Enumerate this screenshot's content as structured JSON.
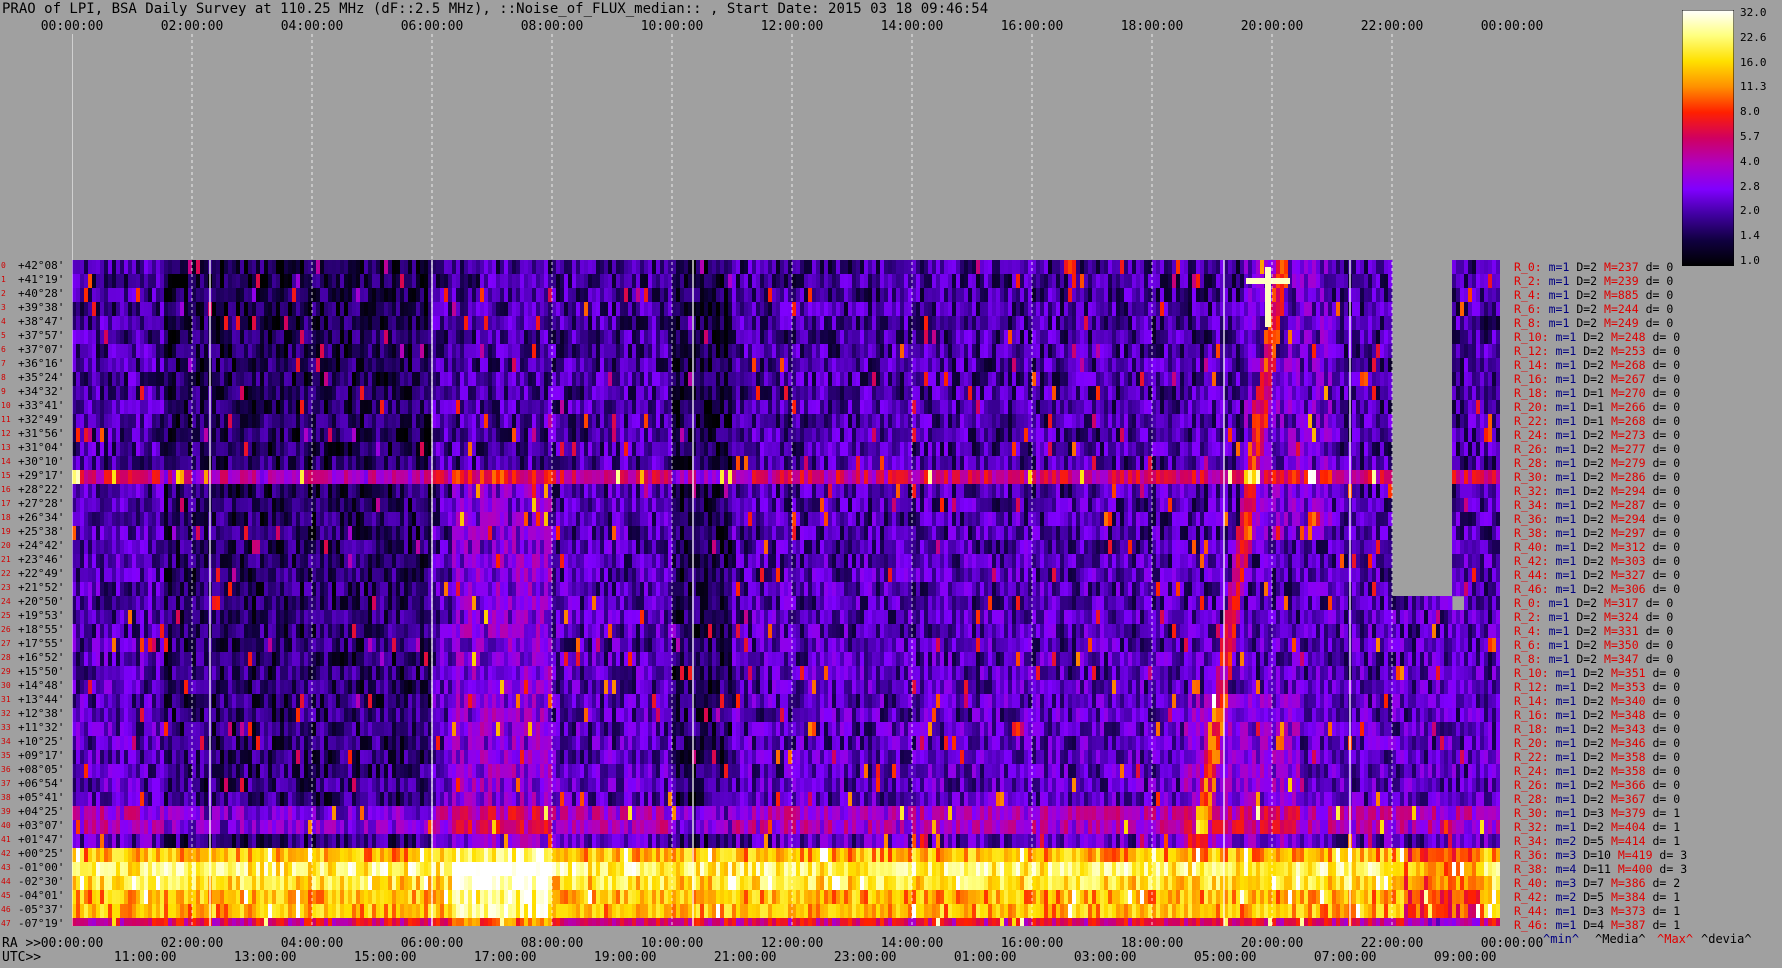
{
  "title": "PRAO of LPI, BSA Daily Survey at 110.25 MHz (dF::2.5 MHz), ::Noise_of_FLUX_median:: , Start Date: 2015 03 18 09:46:54",
  "top_axis": {
    "labels": [
      "00:00:00",
      "02:00:00",
      "04:00:00",
      "06:00:00",
      "08:00:00",
      "10:00:00",
      "12:00:00",
      "14:00:00",
      "16:00:00",
      "18:00:00",
      "20:00:00",
      "22:00:00",
      "00:00:00"
    ]
  },
  "bottom_axes": {
    "ra_prefix": "RA >>",
    "ra_labels": [
      "00:00:00",
      "02:00:00",
      "04:00:00",
      "06:00:00",
      "08:00:00",
      "10:00:00",
      "12:00:00",
      "14:00:00",
      "16:00:00",
      "18:00:00",
      "20:00:00",
      "22:00:00",
      "00:00:00"
    ],
    "utc_prefix": "UTC>>",
    "utc_labels": [
      "11:00:00",
      "13:00:00",
      "15:00:00",
      "17:00:00",
      "19:00:00",
      "21:00:00",
      "23:00:00",
      "01:00:00",
      "03:00:00",
      "05:00:00",
      "07:00:00",
      "09:00:00"
    ]
  },
  "declinations": [
    "+42°08'",
    "+41°19'",
    "+40°28'",
    "+39°38'",
    "+38°47'",
    "+37°57'",
    "+37°07'",
    "+36°16'",
    "+35°24'",
    "+34°32'",
    "+33°41'",
    "+32°49'",
    "+31°56'",
    "+31°04'",
    "+30°10'",
    "+29°17'",
    "+28°22'",
    "+27°28'",
    "+26°34'",
    "+25°38'",
    "+24°42'",
    "+23°46'",
    "+22°49'",
    "+21°52'",
    "+20°50'",
    "+19°53'",
    "+18°55'",
    "+17°55'",
    "+16°52'",
    "+15°50'",
    "+14°48'",
    "+13°44'",
    "+12°38'",
    "+11°32'",
    "+10°25'",
    "+09°17'",
    "+08°05'",
    "+06°54'",
    "+05°41'",
    "+04°25'",
    "+03°07'",
    "+01°47'",
    "+00°25'",
    "-01°00'",
    "-02°30'",
    "-04°01'",
    "-05°37'",
    "-07°19'"
  ],
  "row_indices": [
    "0",
    "1",
    "2",
    "3",
    "4",
    "5",
    "6",
    "7",
    "8",
    "9",
    "10",
    "11",
    "12",
    "13",
    "14",
    "15",
    "16",
    "17",
    "18",
    "19",
    "20",
    "21",
    "22",
    "23",
    "24",
    "25",
    "26",
    "27",
    "28",
    "29",
    "30",
    "31",
    "32",
    "33",
    "34",
    "35",
    "36",
    "37",
    "38",
    "39",
    "40",
    "41",
    "42",
    "43",
    "44",
    "45",
    "46",
    "47"
  ],
  "stats": [
    {
      "r": "R_0:",
      "m": "m=1",
      "d": "D=2",
      "x": "M=237",
      "dv": "d= 0"
    },
    {
      "r": "R_2:",
      "m": "m=1",
      "d": "D=2",
      "x": "M=239",
      "dv": "d= 0"
    },
    {
      "r": "R_4:",
      "m": "m=1",
      "d": "D=2",
      "x": "M=885",
      "dv": "d= 0"
    },
    {
      "r": "R_6:",
      "m": "m=1",
      "d": "D=2",
      "x": "M=244",
      "dv": "d= 0"
    },
    {
      "r": "R_8:",
      "m": "m=1",
      "d": "D=2",
      "x": "M=249",
      "dv": "d= 0"
    },
    {
      "r": "R_10:",
      "m": "m=1",
      "d": "D=2",
      "x": "M=248",
      "dv": "d= 0"
    },
    {
      "r": "R_12:",
      "m": "m=1",
      "d": "D=2",
      "x": "M=253",
      "dv": "d= 0"
    },
    {
      "r": "R_14:",
      "m": "m=1",
      "d": "D=2",
      "x": "M=268",
      "dv": "d= 0"
    },
    {
      "r": "R_16:",
      "m": "m=1",
      "d": "D=2",
      "x": "M=267",
      "dv": "d= 0"
    },
    {
      "r": "R_18:",
      "m": "m=1",
      "d": "D=1",
      "x": "M=270",
      "dv": "d= 0"
    },
    {
      "r": "R_20:",
      "m": "m=1",
      "d": "D=1",
      "x": "M=266",
      "dv": "d= 0"
    },
    {
      "r": "R_22:",
      "m": "m=1",
      "d": "D=1",
      "x": "M=268",
      "dv": "d= 0"
    },
    {
      "r": "R_24:",
      "m": "m=1",
      "d": "D=2",
      "x": "M=273",
      "dv": "d= 0"
    },
    {
      "r": "R_26:",
      "m": "m=1",
      "d": "D=2",
      "x": "M=277",
      "dv": "d= 0"
    },
    {
      "r": "R_28:",
      "m": "m=1",
      "d": "D=2",
      "x": "M=279",
      "dv": "d= 0"
    },
    {
      "r": "R_30:",
      "m": "m=1",
      "d": "D=2",
      "x": "M=286",
      "dv": "d= 0"
    },
    {
      "r": "R_32:",
      "m": "m=1",
      "d": "D=2",
      "x": "M=294",
      "dv": "d= 0"
    },
    {
      "r": "R_34:",
      "m": "m=1",
      "d": "D=2",
      "x": "M=287",
      "dv": "d= 0"
    },
    {
      "r": "R_36:",
      "m": "m=1",
      "d": "D=2",
      "x": "M=294",
      "dv": "d= 0"
    },
    {
      "r": "R_38:",
      "m": "m=1",
      "d": "D=2",
      "x": "M=297",
      "dv": "d= 0"
    },
    {
      "r": "R_40:",
      "m": "m=1",
      "d": "D=2",
      "x": "M=312",
      "dv": "d= 0"
    },
    {
      "r": "R_42:",
      "m": "m=1",
      "d": "D=2",
      "x": "M=303",
      "dv": "d= 0"
    },
    {
      "r": "R_44:",
      "m": "m=1",
      "d": "D=2",
      "x": "M=327",
      "dv": "d= 0"
    },
    {
      "r": "R_46:",
      "m": "m=1",
      "d": "D=2",
      "x": "M=306",
      "dv": "d= 0"
    },
    {
      "r": "R_0:",
      "m": "m=1",
      "d": "D=2",
      "x": "M=317",
      "dv": "d= 0"
    },
    {
      "r": "R_2:",
      "m": "m=1",
      "d": "D=2",
      "x": "M=324",
      "dv": "d= 0"
    },
    {
      "r": "R_4:",
      "m": "m=1",
      "d": "D=2",
      "x": "M=331",
      "dv": "d= 0"
    },
    {
      "r": "R_6:",
      "m": "m=1",
      "d": "D=2",
      "x": "M=350",
      "dv": "d= 0"
    },
    {
      "r": "R_8:",
      "m": "m=1",
      "d": "D=2",
      "x": "M=347",
      "dv": "d= 0"
    },
    {
      "r": "R_10:",
      "m": "m=1",
      "d": "D=2",
      "x": "M=351",
      "dv": "d= 0"
    },
    {
      "r": "R_12:",
      "m": "m=1",
      "d": "D=2",
      "x": "M=353",
      "dv": "d= 0"
    },
    {
      "r": "R_14:",
      "m": "m=1",
      "d": "D=2",
      "x": "M=340",
      "dv": "d= 0"
    },
    {
      "r": "R_16:",
      "m": "m=1",
      "d": "D=2",
      "x": "M=348",
      "dv": "d= 0"
    },
    {
      "r": "R_18:",
      "m": "m=1",
      "d": "D=2",
      "x": "M=343",
      "dv": "d= 0"
    },
    {
      "r": "R_20:",
      "m": "m=1",
      "d": "D=2",
      "x": "M=346",
      "dv": "d= 0"
    },
    {
      "r": "R_22:",
      "m": "m=1",
      "d": "D=2",
      "x": "M=358",
      "dv": "d= 0"
    },
    {
      "r": "R_24:",
      "m": "m=1",
      "d": "D=2",
      "x": "M=358",
      "dv": "d= 0"
    },
    {
      "r": "R_26:",
      "m": "m=1",
      "d": "D=2",
      "x": "M=366",
      "dv": "d= 0"
    },
    {
      "r": "R_28:",
      "m": "m=1",
      "d": "D=2",
      "x": "M=367",
      "dv": "d= 0"
    },
    {
      "r": "R_30:",
      "m": "m=1",
      "d": "D=3",
      "x": "M=379",
      "dv": "d= 1"
    },
    {
      "r": "R_32:",
      "m": "m=1",
      "d": "D=2",
      "x": "M=404",
      "dv": "d= 1"
    },
    {
      "r": "R_34:",
      "m": "m=2",
      "d": "D=5",
      "x": "M=414",
      "dv": "d= 1"
    },
    {
      "r": "R_36:",
      "m": "m=3",
      "d": "D=10",
      "x": "M=419",
      "dv": "d= 3"
    },
    {
      "r": "R_38:",
      "m": "m=4",
      "d": "D=11",
      "x": "M=400",
      "dv": "d= 3"
    },
    {
      "r": "R_40:",
      "m": "m=3",
      "d": "D=7",
      "x": "M=386",
      "dv": "d= 2"
    },
    {
      "r": "R_42:",
      "m": "m=2",
      "d": "D=5",
      "x": "M=384",
      "dv": "d= 1"
    },
    {
      "r": "R_44:",
      "m": "m=1",
      "d": "D=3",
      "x": "M=373",
      "dv": "d= 1"
    },
    {
      "r": "R_46:",
      "m": "m=1",
      "d": "D=4",
      "x": "M=387",
      "dv": "d= 1"
    }
  ],
  "legend": {
    "min": "^min^",
    "media": "^Media^",
    "max": "^Max^",
    "devia": "^devia^"
  },
  "colorbar": {
    "tick_labels": [
      "32.0",
      "22.6",
      "16.0",
      "11.3",
      "8.0",
      "5.7",
      "4.0",
      "2.8",
      "2.0",
      "1.4",
      "1.0"
    ],
    "colors": [
      "#ffffff",
      "#ffff80",
      "#ffe000",
      "#ff9000",
      "#ff2000",
      "#d00060",
      "#b000c0",
      "#8000ff",
      "#4000a0",
      "#100040",
      "#000000"
    ]
  },
  "chart_data": {
    "type": "heatmap",
    "title": "PRAO of LPI, BSA Daily Survey at 110.25 MHz (dF::2.5 MHz), ::Noise_of_FLUX_median:: , Start Date: 2015 03 18 09:46:54",
    "x_axis": "RA 00:00:00 – 24:00:00 (UTC 09:46:54 start)",
    "y_axis": "Declination +42°08' to -07°19' (48 beams)",
    "color_scale": {
      "type": "log",
      "range": [
        1.0,
        32.0
      ]
    },
    "features": {
      "bright_band_rows": [
        42,
        43,
        44,
        45,
        46
      ],
      "horizontal_line_rows": [
        15
      ],
      "strong_source": {
        "ra": "20:00:00",
        "dec": "+41°19'"
      },
      "gap_ra_range": [
        "22:00:00",
        "23:00:00"
      ]
    }
  }
}
